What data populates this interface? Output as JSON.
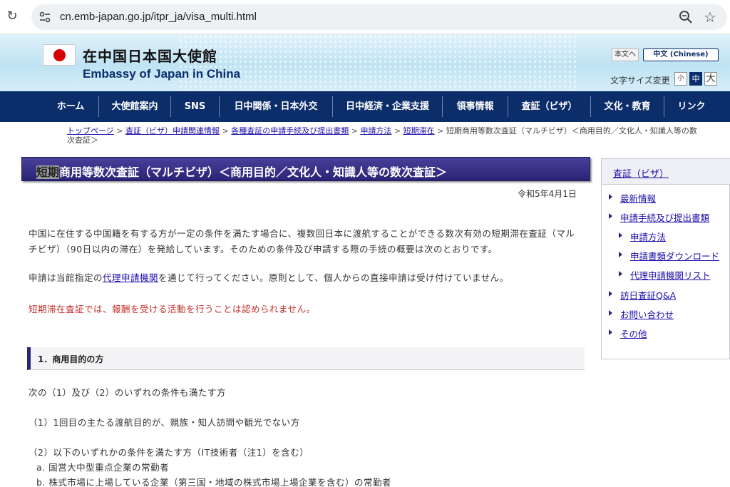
{
  "browser": {
    "url": "cn.emb-japan.go.jp/itpr_ja/visa_multi.html"
  },
  "header": {
    "title_ja": "在中国日本国大使館",
    "title_en": "Embassy of Japan in China",
    "lang_ja": "本文へ",
    "lang_cn": "中文 (Chinese)",
    "fontsize_label": "文字サイズ変更",
    "fontsize_small": "小",
    "fontsize_mid": "中",
    "fontsize_large": "大"
  },
  "nav": {
    "items": [
      "ホーム",
      "大使館案内",
      "SNS",
      "日中関係・日本外交",
      "日中経済・企業支援",
      "領事情報",
      "査証（ビザ）",
      "文化・教育",
      "リンク"
    ]
  },
  "breadcrumb": {
    "links": [
      "トップページ",
      "査証（ビザ）申請関連情報",
      "各種査証の申請手続及び提出書類",
      "申請方法",
      "短期滞在"
    ],
    "separator": ">",
    "current": "短期商用等数次査証（マルチビザ）＜商用目的／文化人・知識人等の数次査証＞"
  },
  "main": {
    "title_highlight": "短期",
    "title_rest": "商用等数次査証（マルチビザ）＜商用目的／文化人・知識人等の数次査証＞",
    "date": "令和5年4月1日",
    "para1_line1": "中国に在住する中国籍を有する方が一定の条件を満たす場合に、複数回日本に渡航することができる数次有効の短期滞在査証（マル",
    "para1_line2": "チビザ）（90日以内の滞在）を発給しています。そのための条件及び申請する際の手続の概要は次のとおりです。",
    "para2_before": "申請は当館指定の",
    "para2_link": "代理申請機関",
    "para2_after": "を通じて行ってください。原則として、個人からの直接申請は受け付けていません。",
    "warning": "短期滞在査証では、報酬を受ける活動を行うことは認められません。",
    "section1_title": "1．商用目的の方",
    "line_condition": "次の（1）及び（2）のいずれの条件も満たす方",
    "line_1": "（1）1回目の主たる渡航目的が、親族・知人訪問や観光でない方",
    "line_2": "（2）以下のいずれかの条件を満たす方（IT技術者（注1）を含む）",
    "line_2a": "a. 国営大中型重点企業の常勤者",
    "line_2b": "b. 株式市場に上場している企業（第三国・地域の株式市場上場企業を含む）の常勤者"
  },
  "sidebar": {
    "title": "査証（ビザ）",
    "items": [
      {
        "label": "最新情報"
      },
      {
        "label": "申請手続及び提出書類"
      },
      {
        "label": "申請方法"
      },
      {
        "label": "申請書類ダウンロード"
      },
      {
        "label": "代理申請機関リスト"
      },
      {
        "label": "訪日査証Q&A"
      },
      {
        "label": "お問い合わせ"
      },
      {
        "label": "その他"
      }
    ]
  },
  "colors": {
    "nav_bg": "#0b2d6a",
    "title_bar": "#2a2476",
    "warning_text": "#c0302a",
    "link": "#1a0dab"
  }
}
